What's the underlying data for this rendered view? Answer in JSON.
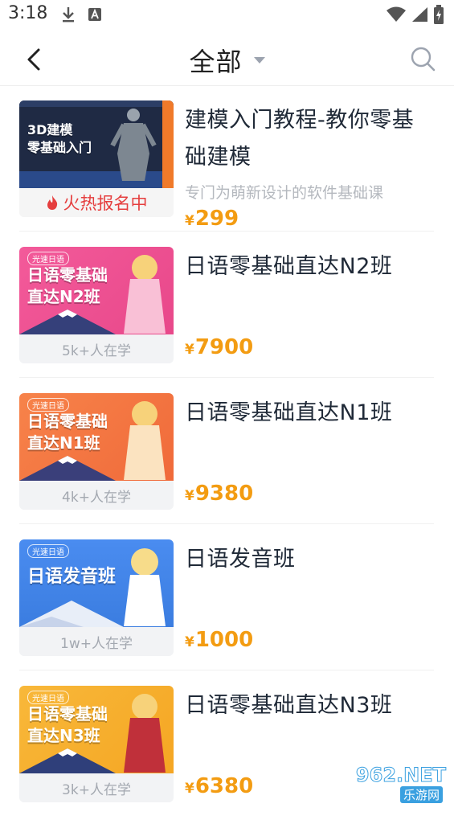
{
  "status_bar": {
    "time": "3:18"
  },
  "header": {
    "title": "全部"
  },
  "courses": [
    {
      "title": "建模入门教程-教你零基础建模",
      "subtitle": "专门为萌新设计的软件基础课",
      "caption": "火热报名中",
      "price_symbol": "¥",
      "price": "299",
      "banner_text": "3D建模\n零基础入门",
      "banner_color": "#1f2a44"
    },
    {
      "title": "日语零基础直达N2班",
      "subtitle": "",
      "caption": "5k+人在学",
      "price_symbol": "¥",
      "price": "7900",
      "banner_text": "日语零基础\n直达N2班",
      "banner_color": "#e8488a"
    },
    {
      "title": "日语零基础直达N1班",
      "subtitle": "",
      "caption": "4k+人在学",
      "price_symbol": "¥",
      "price": "9380",
      "banner_text": "日语零基础\n直达N1班",
      "banner_color": "#f06a3a"
    },
    {
      "title": "日语发音班",
      "subtitle": "",
      "caption": "1w+人在学",
      "price_symbol": "¥",
      "price": "1000",
      "banner_text": "日语发音班",
      "banner_color": "#3b7de0"
    },
    {
      "title": "日语零基础直达N3班",
      "subtitle": "",
      "caption": "3k+人在学",
      "price_symbol": "¥",
      "price": "6380",
      "banner_text": "日语零基础\n直达N3班",
      "banner_color": "#f5a623"
    }
  ],
  "watermark": {
    "text": "962.NET",
    "subtext": "乐游网"
  },
  "colors": {
    "price": "#f39c12",
    "hot": "#e53e3e",
    "divider": "#eeeeee"
  }
}
